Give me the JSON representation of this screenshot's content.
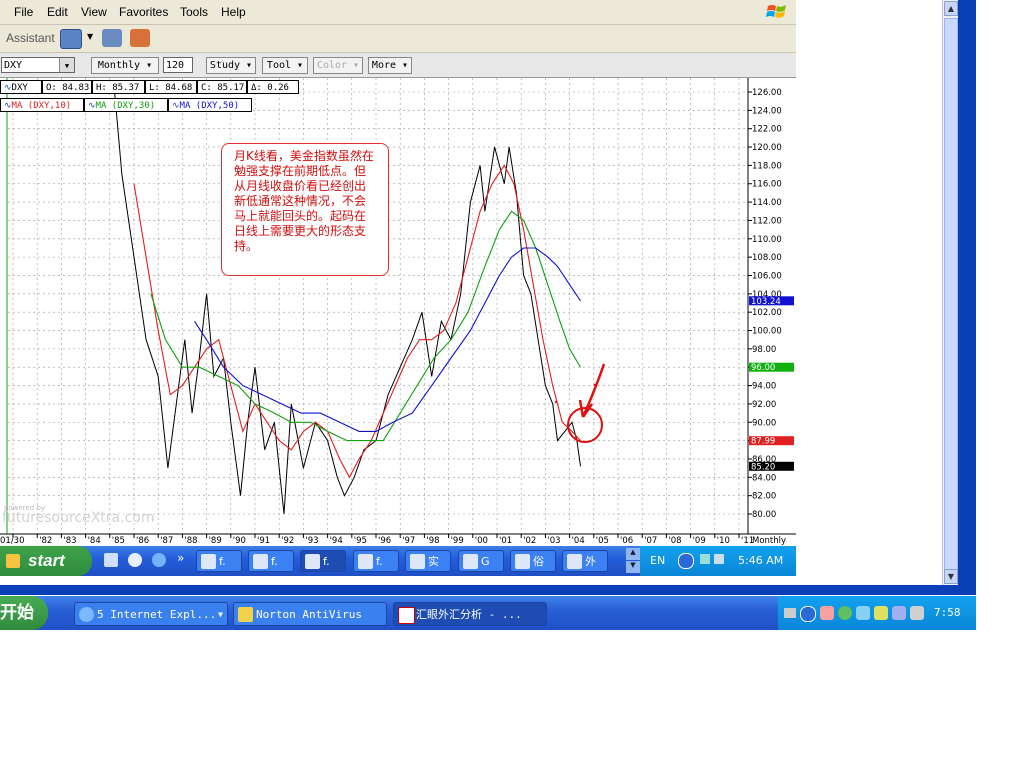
{
  "menu": [
    "File",
    "Edit",
    "View",
    "Favorites",
    "Tools",
    "Help"
  ],
  "assistant_label": "Assistant",
  "chart_toolbar": {
    "symbol": "DXY",
    "period": "Monthly",
    "bars": "120",
    "study": "Study",
    "tool": "Tool",
    "color": "Color",
    "more": "More"
  },
  "quote": {
    "symbol": "DXY",
    "open": "O: 84.83",
    "high": "H: 85.37",
    "low": "L: 84.68",
    "close": "C: 85.17",
    "delta": "Δ: 0.26"
  },
  "ma_legend": [
    "MA (DXY,10)",
    "MA (DXY,30)",
    "MA (DXY,50)"
  ],
  "annotation": "月K线看，美金指数虽然在勉强支撑在前期低点。但从月线收盘价看已经创出新低通常这种情况，不会马上就能回头的。起码在日线上需要更大的形态支持。",
  "watermark": {
    "small": "powered by",
    "main": "futuresourceXtra.com"
  },
  "chart_data": {
    "type": "line",
    "xlabel": "Monthly",
    "x_ticks": [
      "01/30",
      "'82",
      "'83",
      "'84",
      "'85",
      "'86",
      "'87",
      "'88",
      "'89",
      "'90",
      "'91",
      "'92",
      "'93",
      "'94",
      "'95",
      "'96",
      "'97",
      "'98",
      "'99",
      "'00",
      "'01",
      "'02",
      "'03",
      "'04",
      "'05",
      "'06",
      "'07",
      "'08",
      "'09",
      "'10",
      "'11"
    ],
    "y_ticks": [
      "126.00",
      "124.00",
      "122.00",
      "120.00",
      "118.00",
      "116.00",
      "114.00",
      "112.00",
      "110.00",
      "108.00",
      "106.00",
      "104.00",
      "102.00",
      "100.00",
      "98.00",
      "96.00",
      "94.00",
      "92.00",
      "90.00",
      "88.00",
      "86.00",
      "84.00",
      "82.00",
      "80.00"
    ],
    "ylim": [
      80,
      126
    ],
    "price_tags": [
      {
        "label": "103.24",
        "value": 103.24,
        "color": "#1010d0"
      },
      {
        "label": "96.00",
        "value": 96.0,
        "color": "#10b010"
      },
      {
        "label": "87.99",
        "value": 87.99,
        "color": "#e02020"
      },
      {
        "label": "85.20",
        "value": 85.2,
        "color": "#000000"
      }
    ],
    "series": [
      {
        "name": "DXY",
        "color": "#000000",
        "points": [
          [
            1985.7,
            126
          ],
          [
            1986.0,
            117
          ],
          [
            1986.5,
            108
          ],
          [
            1987.0,
            99
          ],
          [
            1987.5,
            95
          ],
          [
            1987.9,
            85
          ],
          [
            1988.2,
            91
          ],
          [
            1988.6,
            99
          ],
          [
            1988.9,
            91
          ],
          [
            1989.2,
            97
          ],
          [
            1989.5,
            104
          ],
          [
            1989.8,
            95
          ],
          [
            1990.2,
            97
          ],
          [
            1990.5,
            90
          ],
          [
            1990.9,
            82
          ],
          [
            1991.2,
            90
          ],
          [
            1991.5,
            96
          ],
          [
            1991.9,
            87
          ],
          [
            1992.3,
            90
          ],
          [
            1992.7,
            80
          ],
          [
            1993.0,
            92
          ],
          [
            1993.5,
            85
          ],
          [
            1994.0,
            90
          ],
          [
            1994.5,
            88
          ],
          [
            1994.9,
            84
          ],
          [
            1995.2,
            82
          ],
          [
            1995.6,
            84
          ],
          [
            1996.0,
            87
          ],
          [
            1996.5,
            88
          ],
          [
            1997.0,
            93
          ],
          [
            1997.5,
            96
          ],
          [
            1998.0,
            99
          ],
          [
            1998.4,
            102
          ],
          [
            1998.8,
            95
          ],
          [
            1999.2,
            101
          ],
          [
            1999.6,
            99
          ],
          [
            2000.0,
            104
          ],
          [
            2000.4,
            114
          ],
          [
            2000.8,
            118
          ],
          [
            2001.0,
            113
          ],
          [
            2001.4,
            120
          ],
          [
            2001.8,
            116
          ],
          [
            2002.0,
            120
          ],
          [
            2002.3,
            115
          ],
          [
            2002.6,
            106
          ],
          [
            2002.9,
            104
          ],
          [
            2003.2,
            99
          ],
          [
            2003.5,
            94
          ],
          [
            2003.8,
            92
          ],
          [
            2004.0,
            88
          ],
          [
            2004.3,
            89
          ],
          [
            2004.6,
            90
          ],
          [
            2004.8,
            88
          ],
          [
            2004.95,
            85.2
          ]
        ]
      },
      {
        "name": "MA (DXY,10)",
        "color": "#e02020",
        "points": [
          [
            1986.5,
            116
          ],
          [
            1987.0,
            108
          ],
          [
            1987.5,
            100
          ],
          [
            1988.0,
            93
          ],
          [
            1988.5,
            94
          ],
          [
            1989.0,
            96
          ],
          [
            1989.5,
            98
          ],
          [
            1990.0,
            99
          ],
          [
            1990.5,
            94
          ],
          [
            1991.0,
            89
          ],
          [
            1991.5,
            92
          ],
          [
            1992.0,
            90
          ],
          [
            1992.5,
            88
          ],
          [
            1993.0,
            87
          ],
          [
            1993.5,
            89
          ],
          [
            1994.0,
            90
          ],
          [
            1994.5,
            89
          ],
          [
            1995.0,
            86
          ],
          [
            1995.4,
            84
          ],
          [
            1995.8,
            86
          ],
          [
            1996.3,
            88
          ],
          [
            1996.8,
            91
          ],
          [
            1997.3,
            94
          ],
          [
            1997.8,
            97
          ],
          [
            1998.3,
            99
          ],
          [
            1998.8,
            99
          ],
          [
            1999.3,
            100
          ],
          [
            1999.8,
            103
          ],
          [
            2000.3,
            108
          ],
          [
            2000.8,
            113
          ],
          [
            2001.3,
            116
          ],
          [
            2001.8,
            118
          ],
          [
            2002.2,
            116
          ],
          [
            2002.6,
            111
          ],
          [
            2003.0,
            105
          ],
          [
            2003.4,
            99
          ],
          [
            2003.8,
            94
          ],
          [
            2004.2,
            90
          ],
          [
            2004.6,
            89
          ],
          [
            2004.95,
            88
          ]
        ]
      },
      {
        "name": "MA (DXY,30)",
        "color": "#10a010",
        "points": [
          [
            1987.2,
            104
          ],
          [
            1987.8,
            99
          ],
          [
            1988.5,
            96
          ],
          [
            1989.2,
            96
          ],
          [
            1990.0,
            95
          ],
          [
            1990.8,
            94
          ],
          [
            1991.5,
            92
          ],
          [
            1992.3,
            91
          ],
          [
            1993.0,
            90
          ],
          [
            1993.8,
            90
          ],
          [
            1994.5,
            89
          ],
          [
            1995.3,
            88
          ],
          [
            1996.0,
            88
          ],
          [
            1996.8,
            88
          ],
          [
            1997.5,
            91
          ],
          [
            1998.2,
            94
          ],
          [
            1998.9,
            97
          ],
          [
            1999.6,
            99
          ],
          [
            2000.3,
            102
          ],
          [
            2001.0,
            107
          ],
          [
            2001.6,
            111
          ],
          [
            2002.1,
            113
          ],
          [
            2002.6,
            112
          ],
          [
            2003.1,
            109
          ],
          [
            2003.6,
            105
          ],
          [
            2004.1,
            101
          ],
          [
            2004.5,
            98
          ],
          [
            2004.95,
            96
          ]
        ]
      },
      {
        "name": "MA (DXY,50)",
        "color": "#1010d0",
        "points": [
          [
            1989.0,
            101
          ],
          [
            1989.5,
            99
          ],
          [
            1990.2,
            96
          ],
          [
            1991.0,
            94
          ],
          [
            1991.8,
            93
          ],
          [
            1992.6,
            92
          ],
          [
            1993.4,
            91
          ],
          [
            1994.2,
            91
          ],
          [
            1995.0,
            90
          ],
          [
            1995.8,
            89
          ],
          [
            1996.5,
            89
          ],
          [
            1997.2,
            90
          ],
          [
            1998.0,
            91
          ],
          [
            1998.8,
            94
          ],
          [
            1999.6,
            97
          ],
          [
            2000.4,
            100
          ],
          [
            2001.0,
            103
          ],
          [
            2001.6,
            106
          ],
          [
            2002.1,
            108
          ],
          [
            2002.6,
            109
          ],
          [
            2003.1,
            109
          ],
          [
            2003.6,
            108
          ],
          [
            2004.0,
            107
          ],
          [
            2004.5,
            105
          ],
          [
            2004.95,
            103.24
          ]
        ]
      }
    ]
  },
  "inner_taskbar": {
    "start": "start",
    "items": [
      "f.",
      "f.",
      "f.",
      "f.",
      "实",
      "G",
      "俗",
      "外"
    ],
    "lang": "EN",
    "time": "5:46 AM"
  },
  "outer_taskbar": {
    "start": "开始",
    "items": [
      "5 Internet Expl...",
      "Norton AntiVirus",
      "汇眼外汇分析 - ..."
    ],
    "time": "7:58"
  },
  "colors": {
    "ma10": "#e02020",
    "ma30": "#10a010",
    "ma50": "#1010d0",
    "xp_blue": "#245edb",
    "xp_green": "#3fa34a"
  }
}
